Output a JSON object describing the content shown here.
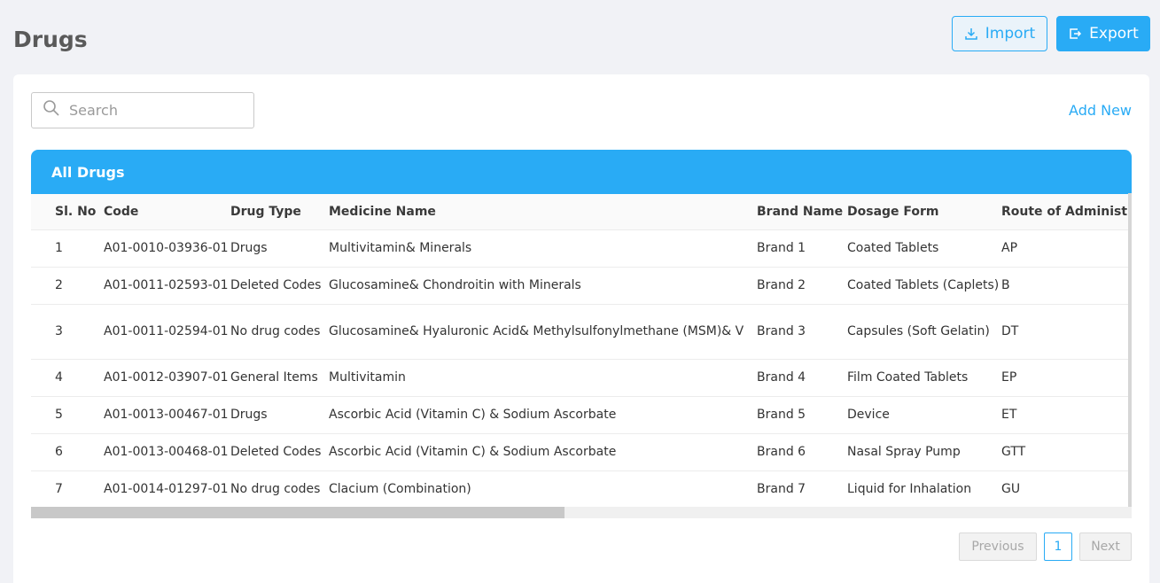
{
  "page": {
    "title": "Drugs"
  },
  "toolbar": {
    "import_label": "Import",
    "export_label": "Export"
  },
  "search": {
    "placeholder": "Search"
  },
  "actions": {
    "add_new_label": "Add New"
  },
  "table": {
    "title": "All Drugs",
    "columns": [
      "Sl. No",
      "Code",
      "Drug Type",
      "Medicine Name",
      "Brand Name",
      "Dosage Form",
      "Route of Administration"
    ],
    "rows": [
      [
        "1",
        "A01-0010-03936-01",
        "Drugs",
        "Multivitamin& Minerals",
        "Brand 1",
        "Coated Tablets",
        "AP"
      ],
      [
        "2",
        "A01-0011-02593-01",
        "Deleted Codes",
        "Glucosamine& Chondroitin with Minerals",
        "Brand 2",
        "Coated Tablets (Caplets)",
        "B"
      ],
      [
        "3",
        "A01-0011-02594-01",
        "No drug codes",
        "Glucosamine& Hyaluronic Acid& Methylsulfonylmethane (MSM)& V",
        "Brand 3",
        "Capsules (Soft Gelatin)",
        "DT"
      ],
      [
        "4",
        "A01-0012-03907-01",
        "General Items",
        "Multivitamin",
        "Brand 4",
        "Film Coated Tablets",
        "EP"
      ],
      [
        "5",
        "A01-0013-00467-01",
        "Drugs",
        "Ascorbic Acid (Vitamin C) & Sodium Ascorbate",
        "Brand 5",
        "Device",
        "ET"
      ],
      [
        "6",
        "A01-0013-00468-01",
        "Deleted Codes",
        "Ascorbic Acid (Vitamin C) & Sodium Ascorbate",
        "Brand 6",
        "Nasal Spray Pump",
        "GTT"
      ],
      [
        "7",
        "A01-0014-01297-01",
        "No drug codes",
        "Clacium (Combination)",
        "Brand 7",
        "Liquid for Inhalation",
        "GU"
      ]
    ]
  },
  "pagination": {
    "previous_label": "Previous",
    "current_page": "1",
    "next_label": "Next"
  },
  "colors": {
    "accent": "#29abf5",
    "background": "#f1f2f6"
  },
  "icons": {
    "import": "download-icon",
    "export": "export-icon",
    "search": "search-icon"
  }
}
